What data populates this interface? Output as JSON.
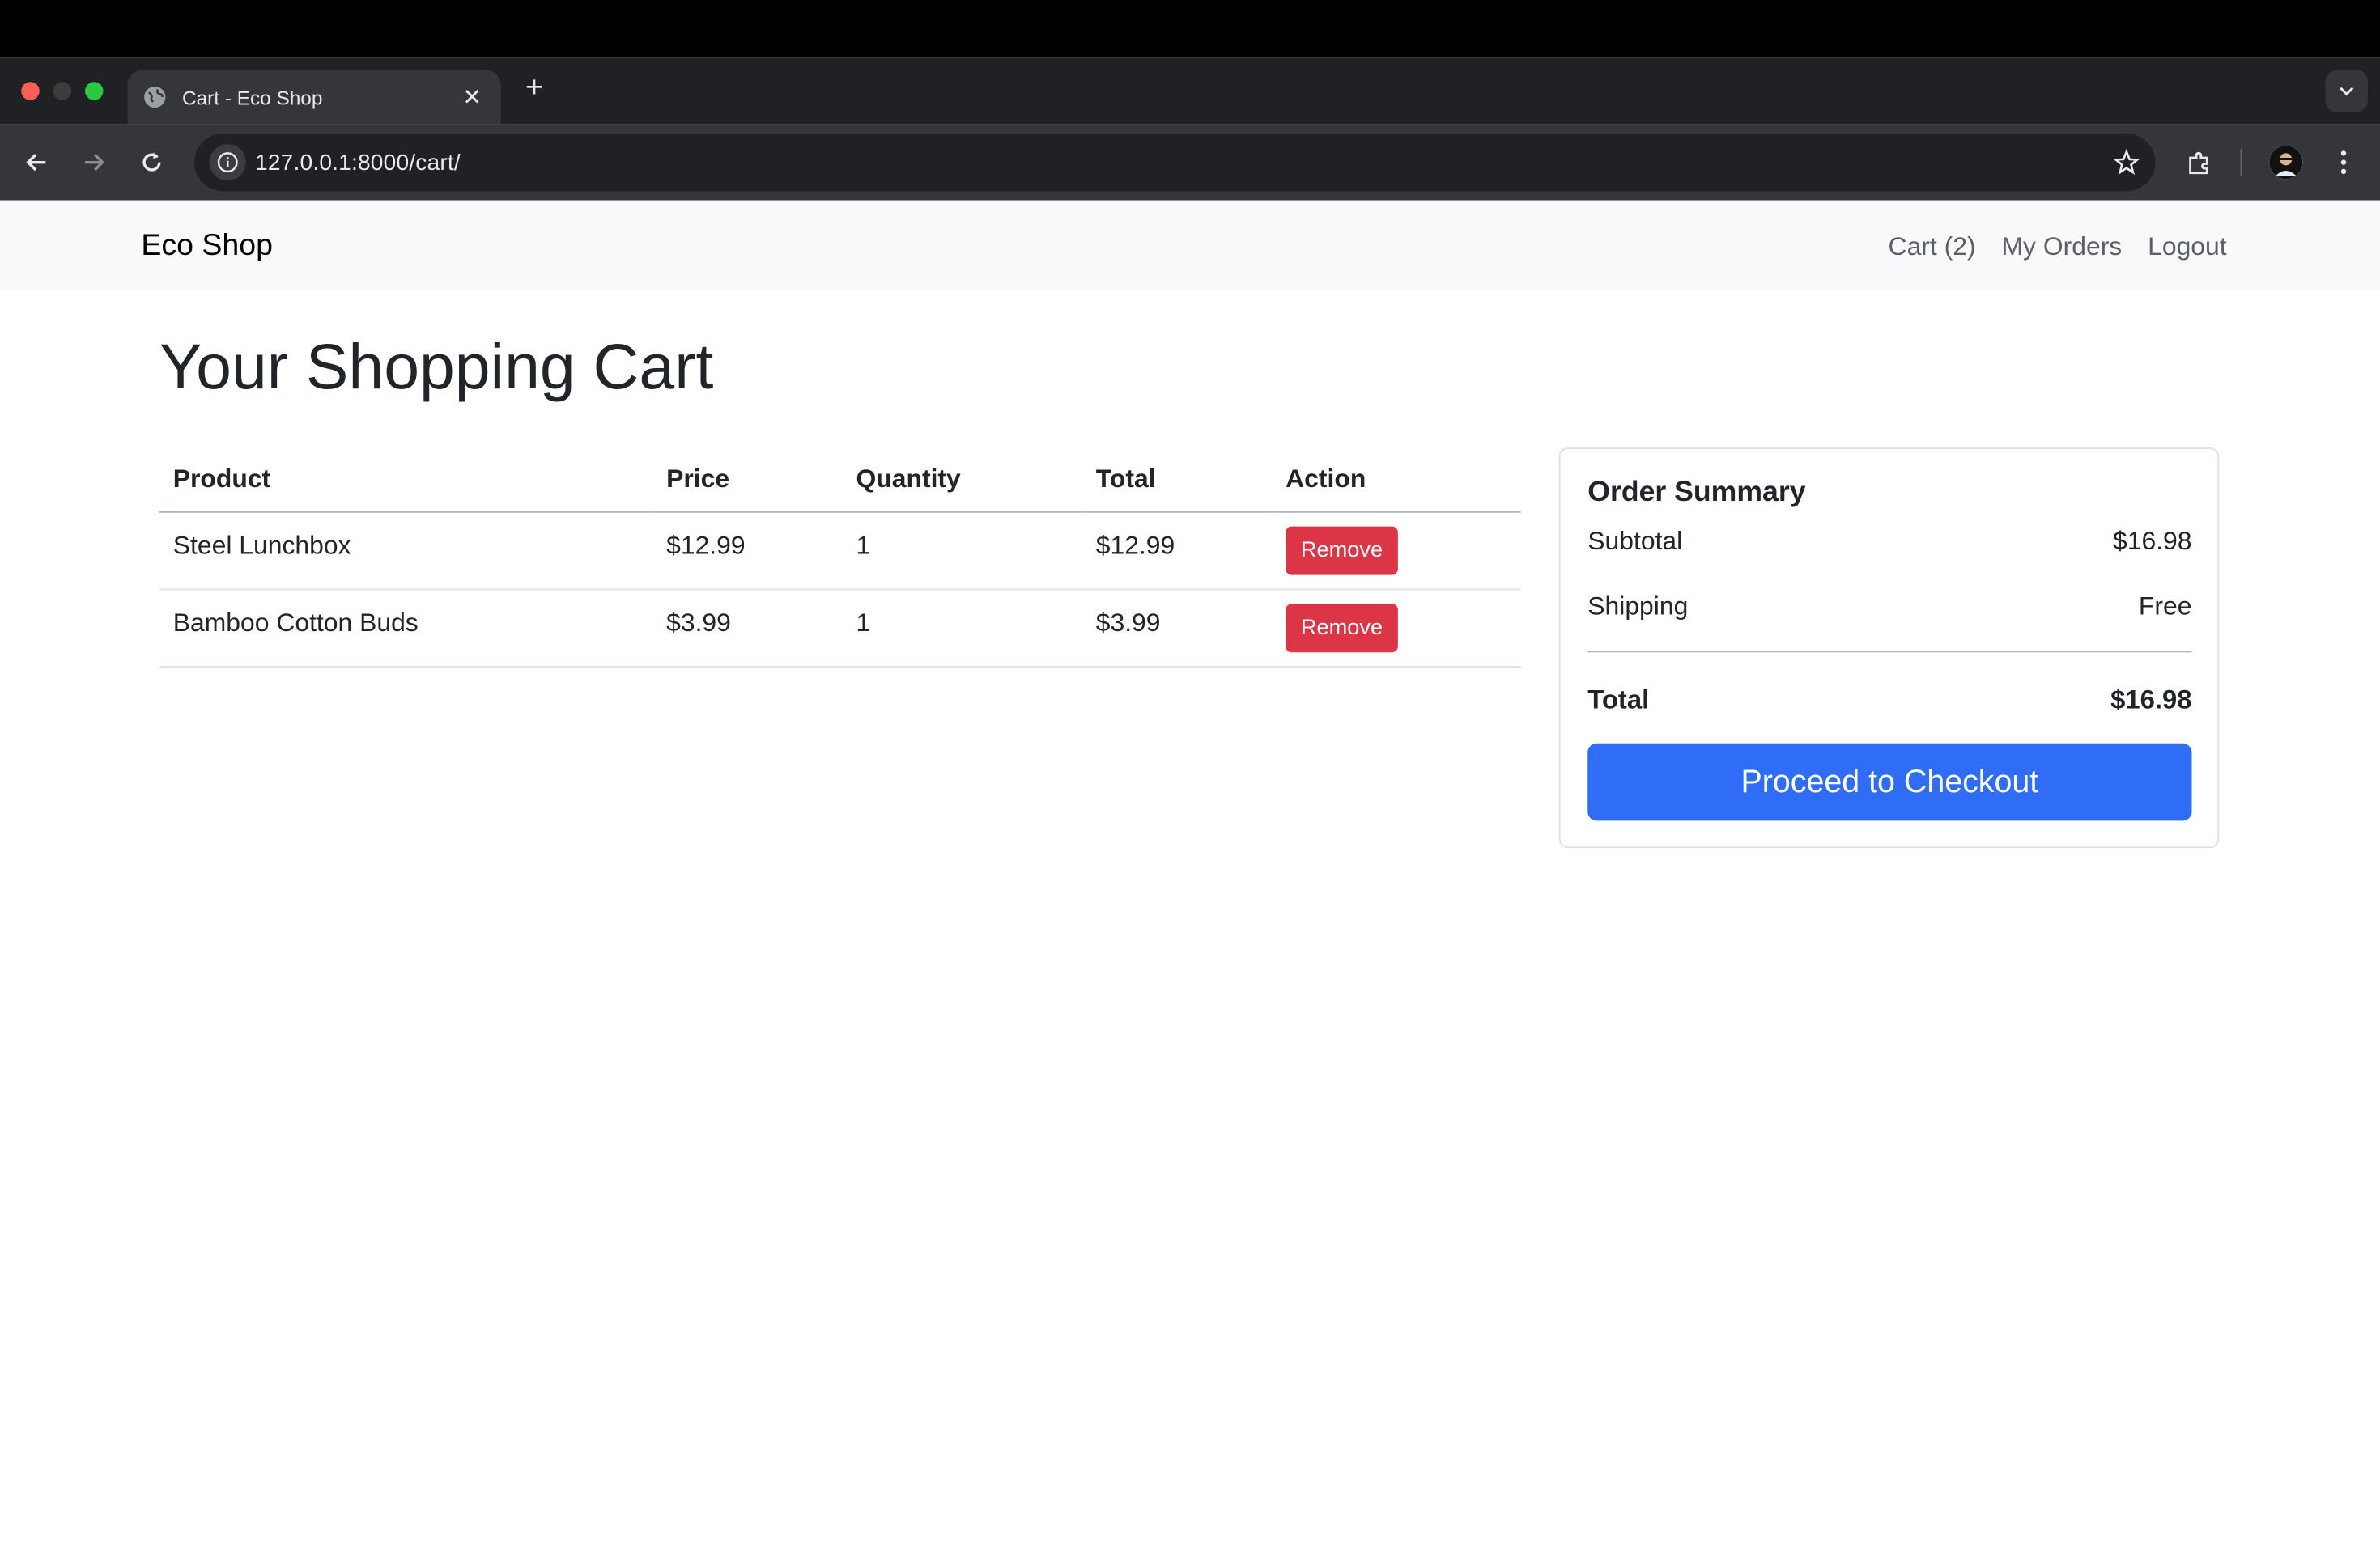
{
  "browser": {
    "tab_title": "Cart - Eco Shop",
    "url": "127.0.0.1:8000/cart/",
    "icons": [
      "globe-icon",
      "close-icon",
      "plus-icon",
      "chevron-down-icon",
      "back-arrow-icon",
      "forward-arrow-icon",
      "reload-icon",
      "info-icon",
      "star-icon",
      "extensions-icon",
      "avatar",
      "kebab-menu-icon"
    ]
  },
  "navbar": {
    "brand": "Eco Shop",
    "links": [
      "Cart (2)",
      "My Orders",
      "Logout"
    ]
  },
  "page": {
    "title": "Your Shopping Cart"
  },
  "cart": {
    "columns": [
      "Product",
      "Price",
      "Quantity",
      "Total",
      "Action"
    ],
    "rows": [
      {
        "product": "Steel Lunchbox",
        "price": "$12.99",
        "quantity": "1",
        "total": "$12.99",
        "action": "Remove"
      },
      {
        "product": "Bamboo Cotton Buds",
        "price": "$3.99",
        "quantity": "1",
        "total": "$3.99",
        "action": "Remove"
      }
    ]
  },
  "summary": {
    "title": "Order Summary",
    "subtotal_label": "Subtotal",
    "subtotal_value": "$16.98",
    "shipping_label": "Shipping",
    "shipping_value": "Free",
    "total_label": "Total",
    "total_value": "$16.98",
    "checkout_label": "Proceed to Checkout"
  },
  "colors": {
    "remove_button": "#dc3545",
    "checkout_button": "#2f6df6",
    "navbar_bg": "#f8f9fa"
  }
}
